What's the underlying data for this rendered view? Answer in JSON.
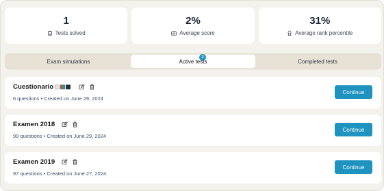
{
  "stats": [
    {
      "value": "1",
      "label": "Tests solved",
      "icon": "clipboard-icon"
    },
    {
      "value": "2%",
      "label": "Average score",
      "icon": "scoreboard-icon"
    },
    {
      "value": "31%",
      "label": "Average rank percentile",
      "icon": "medal-icon"
    }
  ],
  "tabs": [
    {
      "label": "Exam simulations",
      "active": false
    },
    {
      "label": "Active tests",
      "active": true,
      "badge": "3"
    },
    {
      "label": "Completed tests",
      "active": false
    }
  ],
  "tests": [
    {
      "title": "Cuestionario",
      "meta": "6 questions • Created on June 29, 2024",
      "has_emoji": true
    },
    {
      "title": "Examen 2018",
      "meta": "99 questions • Created on June 29, 2024",
      "has_emoji": false
    },
    {
      "title": "Examen 2019",
      "meta": "97 questions • Created on June 27, 2024",
      "has_emoji": false
    }
  ],
  "continue_label": "Continue",
  "colors": {
    "accent": "#1f93c0",
    "background": "#f4f2ed",
    "tab_bar": "#e8e2d6"
  }
}
